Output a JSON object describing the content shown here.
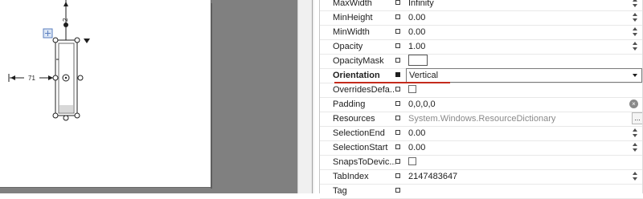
{
  "designer": {
    "spacing_top": "2",
    "spacing_left": "71"
  },
  "properties": [
    {
      "name": "MaxWidth",
      "value": "Infinity",
      "editor": "spin",
      "bold": false,
      "set": false
    },
    {
      "name": "MinHeight",
      "value": "0.00",
      "editor": "spin",
      "bold": false,
      "set": false
    },
    {
      "name": "MinWidth",
      "value": "0.00",
      "editor": "spin",
      "bold": false,
      "set": false
    },
    {
      "name": "Opacity",
      "value": "1.00",
      "editor": "spin",
      "bold": false,
      "set": false
    },
    {
      "name": "OpacityMask",
      "value": "",
      "editor": "brush",
      "bold": false,
      "set": false
    },
    {
      "name": "Orientation",
      "value": "Vertical",
      "editor": "combo",
      "bold": true,
      "set": true
    },
    {
      "name": "OverridesDefa...",
      "value": "",
      "editor": "checkbox",
      "bold": false,
      "set": false
    },
    {
      "name": "Padding",
      "value": "0,0,0,0",
      "editor": "clear",
      "bold": false,
      "set": false
    },
    {
      "name": "Resources",
      "value": "System.Windows.ResourceDictionary",
      "editor": "ellipsis",
      "bold": false,
      "set": false
    },
    {
      "name": "SelectionEnd",
      "value": "0.00",
      "editor": "spin",
      "bold": false,
      "set": false
    },
    {
      "name": "SelectionStart",
      "value": "0.00",
      "editor": "spin",
      "bold": false,
      "set": false
    },
    {
      "name": "SnapsToDevic...",
      "value": "",
      "editor": "checkbox",
      "bold": false,
      "set": false
    },
    {
      "name": "TabIndex",
      "value": "2147483647",
      "editor": "spin",
      "bold": false,
      "set": false
    },
    {
      "name": "Tag",
      "value": "",
      "editor": "text",
      "bold": false,
      "set": false
    }
  ],
  "ellipsis_label": "...",
  "clear_label": "×",
  "colors": {
    "accent_underline": "#c42b1c",
    "canvas_bg": "#808080"
  }
}
